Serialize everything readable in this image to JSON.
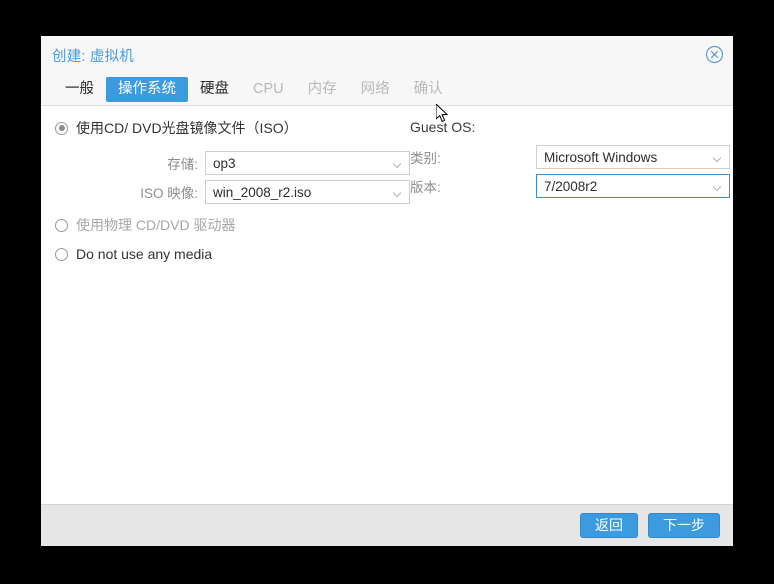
{
  "window": {
    "title": "创建: 虚拟机",
    "close_icon": "close-circle-icon"
  },
  "tabs": [
    {
      "label": "一般",
      "state": "enabled"
    },
    {
      "label": "操作系统",
      "state": "active"
    },
    {
      "label": "硬盘",
      "state": "enabled"
    },
    {
      "label": "CPU",
      "state": "disabled"
    },
    {
      "label": "内存",
      "state": "disabled"
    },
    {
      "label": "网络",
      "state": "disabled"
    },
    {
      "label": "确认",
      "state": "disabled"
    }
  ],
  "media": {
    "option_iso": "使用CD/ DVD光盘镜像文件（ISO）",
    "option_physical": "使用物理 CD/DVD 驱动器",
    "option_none": "Do not use any media",
    "storage_label": "存储:",
    "storage_value": "op3",
    "iso_label": "ISO 映像:",
    "iso_value": "win_2008_r2.iso"
  },
  "guest_os": {
    "heading": "Guest OS:",
    "type_label": "类别:",
    "type_value": "Microsoft Windows",
    "version_label": "版本:",
    "version_value": "7/2008r2"
  },
  "footer": {
    "back_label": "返回",
    "next_label": "下一步"
  },
  "colors": {
    "accent": "#3c9ade",
    "title": "#4d9ad6",
    "focus_border": "#3c8fcf",
    "header_bg": "#f7f7f7",
    "footer_bg": "#e6e6e6"
  }
}
